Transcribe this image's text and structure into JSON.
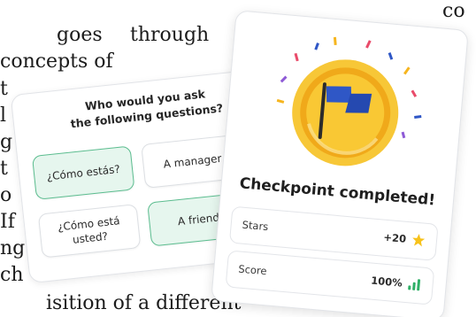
{
  "background_text": {
    "word_goes": "goes",
    "word_through": "through",
    "word_concepts_of": "concepts of",
    "word_co": "co",
    "frag_t": "t",
    "frag_l": "l",
    "frag_g": "g",
    "frag_t2": "t",
    "frag_o": "o",
    "frag_if": "If",
    "frag_ng": "ng",
    "frag_ch": "ch",
    "bottom_line": "isition of a different"
  },
  "quiz": {
    "question_line1": "Who would you ask",
    "question_line2": "the following questions?",
    "options": [
      {
        "label": "¿Cómo estás?",
        "selected": true
      },
      {
        "label": "A manager",
        "selected": false
      },
      {
        "label": "¿Cómo está usted?",
        "selected": false
      },
      {
        "label": "A friend",
        "selected": true
      }
    ]
  },
  "checkpoint": {
    "title": "Checkpoint completed!",
    "stats": {
      "stars_label": "Stars",
      "stars_value": "+20",
      "score_label": "Score",
      "score_value": "100%"
    }
  },
  "colors": {
    "selected_bg": "#e6f6ee",
    "selected_border": "#5bbd8f",
    "medal_gold": "#f6b51e",
    "flag_blue": "#2f57c6",
    "star_yellow": "#f7c21b",
    "bars_green": "#2fb067"
  },
  "icons": [
    "medal-icon",
    "flag-icon",
    "star-icon",
    "signal-bars-icon"
  ]
}
